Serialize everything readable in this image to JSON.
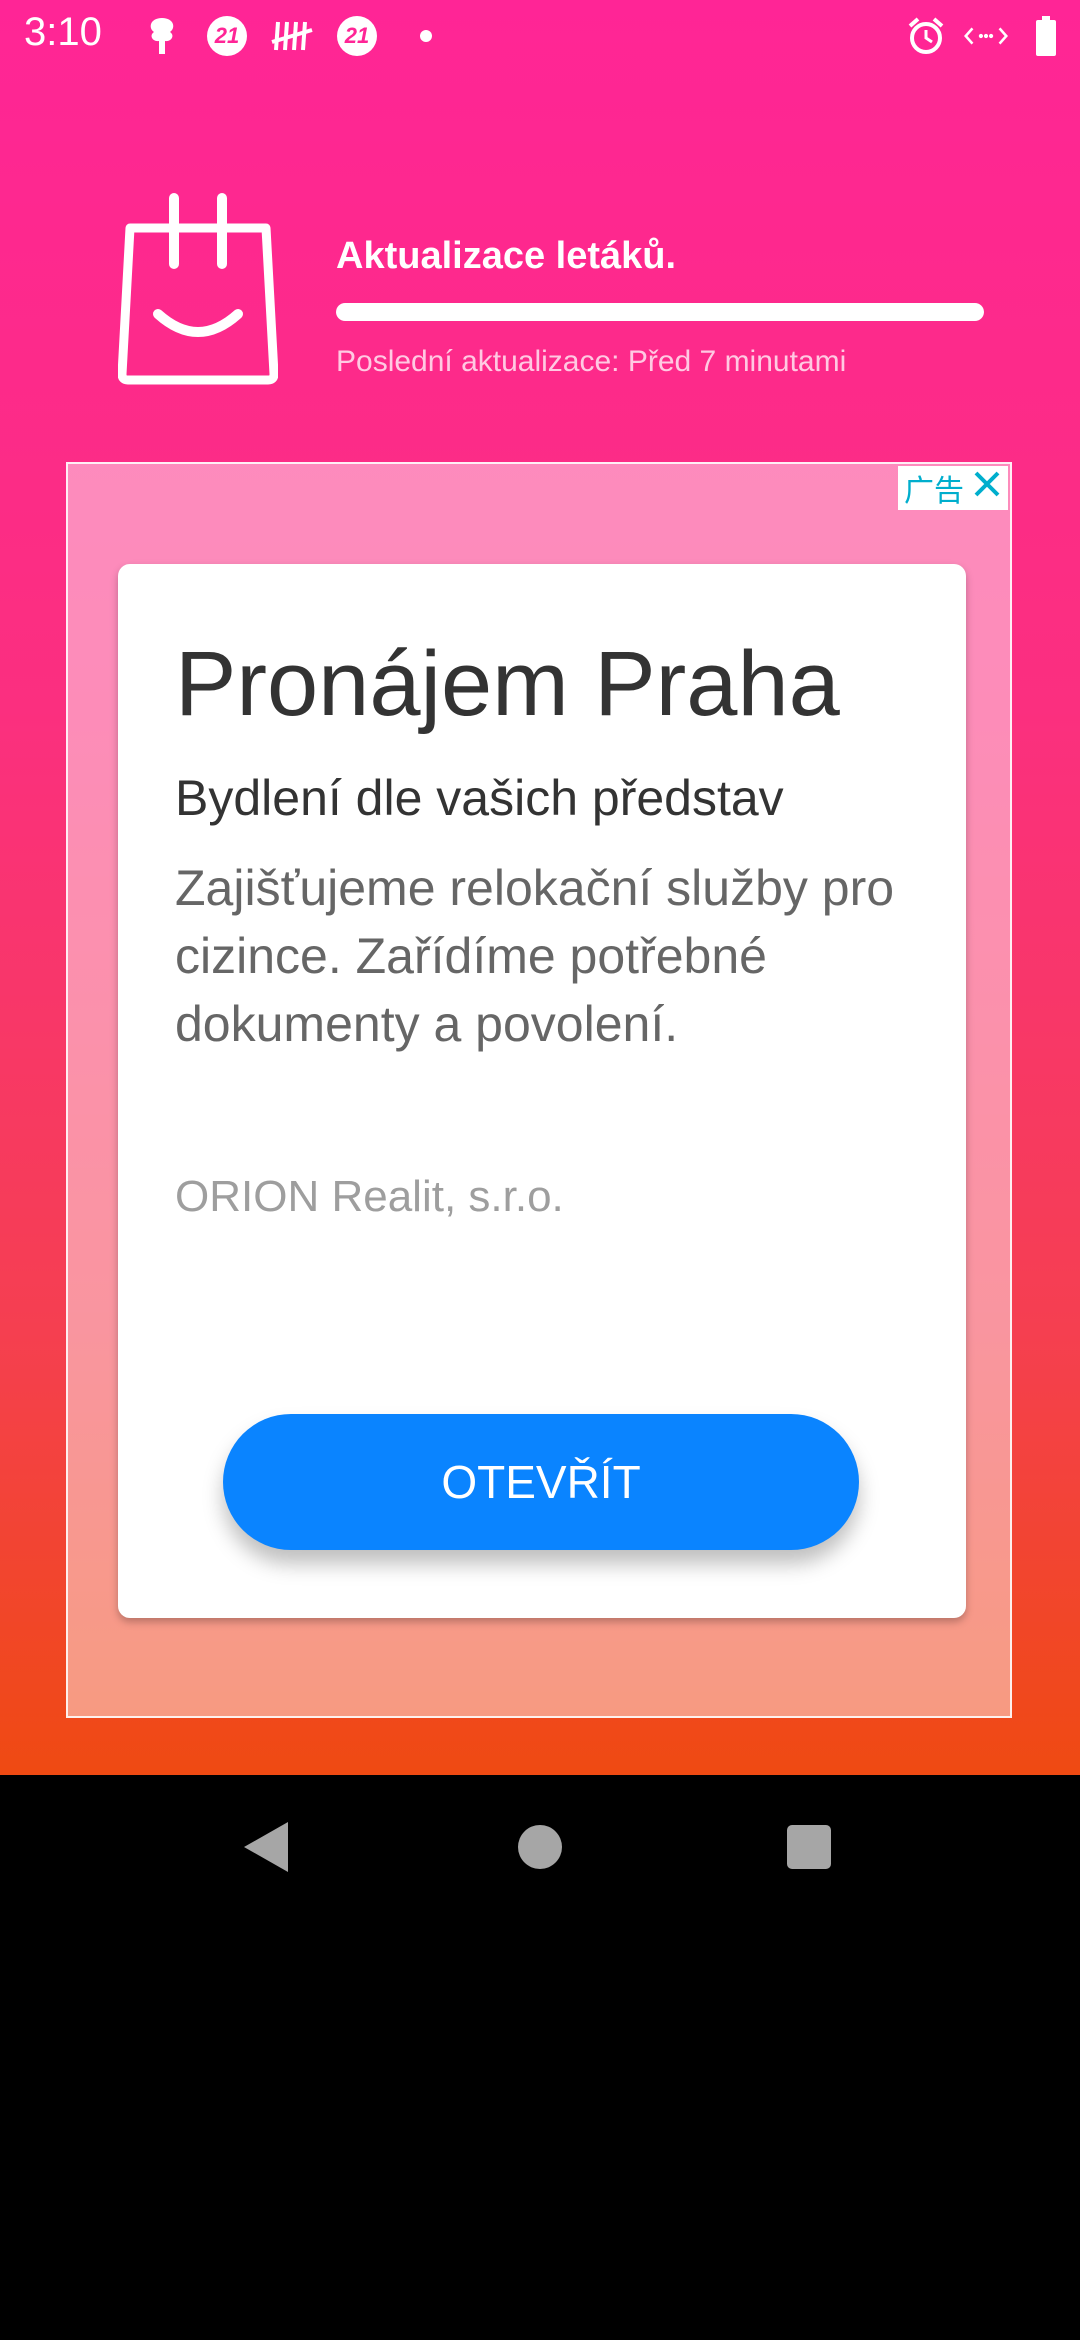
{
  "status_bar": {
    "time": "3:10",
    "icons": [
      "tree-icon",
      "badge-21-icon",
      "tally-icon",
      "badge-21-icon",
      "dot-icon",
      "alarm-icon",
      "vibrate-icon",
      "battery-icon"
    ],
    "badge_text": "21"
  },
  "header": {
    "logo_icon": "shopping-bag-smile-icon",
    "title": "Aktualizace letáků.",
    "progress": 1.0,
    "last_update": "Poslední aktualizace: Před 7 minutami"
  },
  "ad": {
    "badge_label": "广告",
    "close_icon": "close-icon",
    "headline": "Pronájem Praha",
    "subheadline": "Bydlení dle vašich představ",
    "body": "Zajišťujeme relokační služby pro cizince. Zařídíme potřebné dokumenty a povolení.",
    "advertiser": "ORION Realit, s.r.o.",
    "cta": "OTEVŘÍT"
  },
  "nav": {
    "back_icon": "back-icon",
    "home_icon": "home-icon",
    "recents_icon": "recents-icon"
  },
  "colors": {
    "gradient_top": "#ff2596",
    "gradient_bottom": "#ef4a12",
    "cta_blue": "#0a84ff",
    "ad_badge_teal": "#00aecd"
  }
}
